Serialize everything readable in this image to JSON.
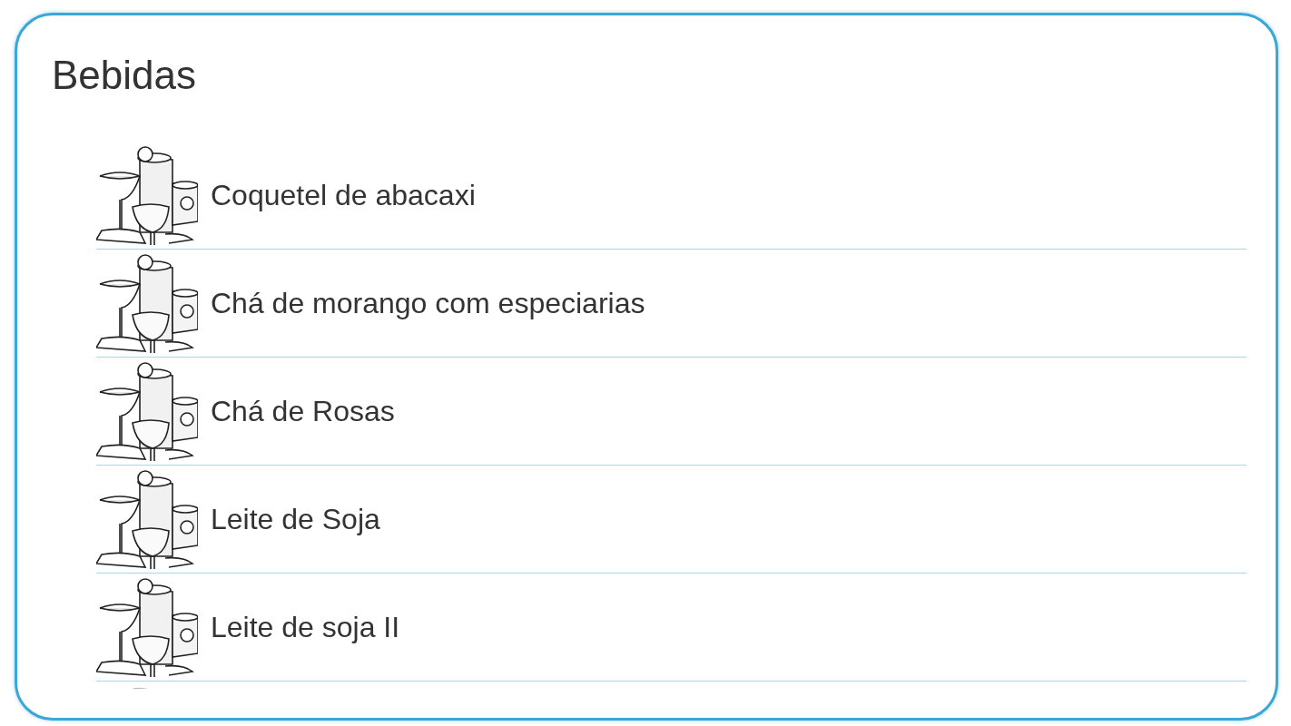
{
  "title": "Bebidas",
  "items": [
    {
      "label": "Coquetel de abacaxi"
    },
    {
      "label": "Chá de morango com especiarias"
    },
    {
      "label": "Chá de Rosas"
    },
    {
      "label": "Leite de Soja"
    },
    {
      "label": "Leite de soja II"
    }
  ]
}
